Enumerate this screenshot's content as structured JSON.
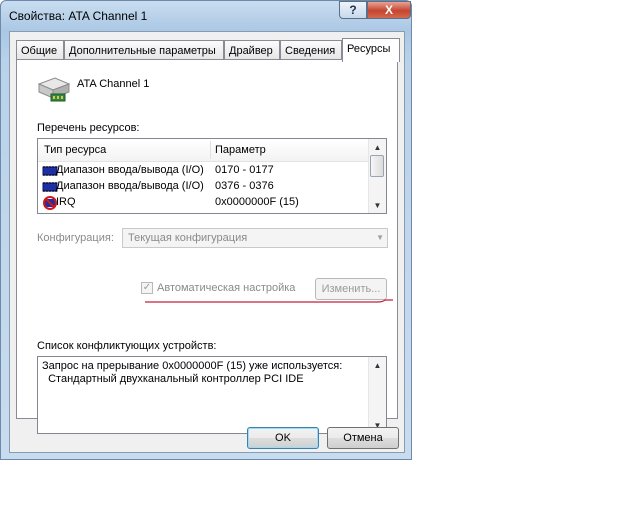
{
  "window": {
    "title": "Свойства: ATA Channel 1",
    "help_glyph": "?",
    "close_glyph": "X"
  },
  "tabs": [
    {
      "label": "Общие"
    },
    {
      "label": "Дополнительные параметры"
    },
    {
      "label": "Драйвер"
    },
    {
      "label": "Сведения"
    },
    {
      "label": "Ресурсы",
      "selected": true
    }
  ],
  "device": {
    "name": "ATA Channel 1",
    "icon": "ide-controller-icon"
  },
  "resources": {
    "label": "Перечень ресурсов:",
    "columns": [
      "Тип ресурса",
      "Параметр"
    ],
    "rows": [
      {
        "type": "Диапазон ввода/вывода (I/O)",
        "value": "0170 - 0177",
        "icon": "io-range-icon"
      },
      {
        "type": "Диапазон ввода/вывода (I/O)",
        "value": "0376 - 0376",
        "icon": "io-range-icon"
      },
      {
        "type": "IRQ",
        "value": "0x0000000F (15)",
        "icon": "irq-conflict-icon"
      }
    ]
  },
  "config": {
    "label": "Конфигурация:",
    "value": "Текущая конфигурация"
  },
  "auto": {
    "label": "Автоматическая настройка",
    "checked": true
  },
  "change_button": "Изменить...",
  "conflicts": {
    "label": "Список конфликтующих устройств:",
    "text": "Запрос на прерывание 0x0000000F (15) уже используется:\n  Стандартный двухканальный контроллер PCI IDE"
  },
  "buttons": {
    "ok": "OK",
    "cancel": "Отмена"
  },
  "colors": {
    "annotation_underline": "#c0203a",
    "ok_focus": "#3c7fb1"
  }
}
